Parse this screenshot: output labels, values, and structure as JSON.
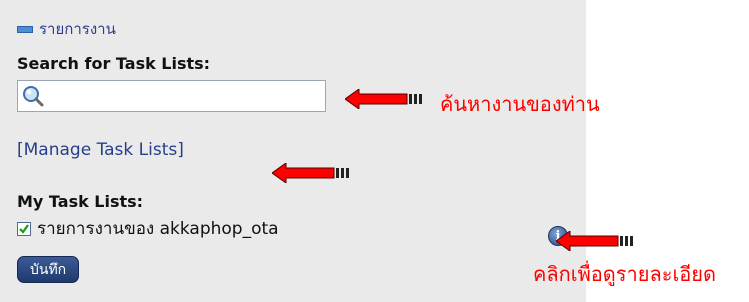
{
  "panel": {
    "section_title": "รายการงาน",
    "search_label": "Search for Task Lists:",
    "search_value": "",
    "manage_link": "[Manage Task Lists]",
    "my_lists_label": "My Task Lists:",
    "task_list_item": "รายการงานของ akkaphop_ota",
    "task_list_checked": true,
    "save_button": "บันทึก"
  },
  "annotations": {
    "search_hint": "ค้นหางานของท่าน",
    "info_hint": "คลิกเพื่อดูรายละเอียด"
  },
  "colors": {
    "panel_bg": "#eaeaea",
    "link": "#27408b",
    "annotation": "#ff0000",
    "button": "#2b4a85"
  },
  "icons": [
    "minus-icon",
    "search-icon",
    "check-icon",
    "info-icon",
    "red-arrow-icon"
  ]
}
